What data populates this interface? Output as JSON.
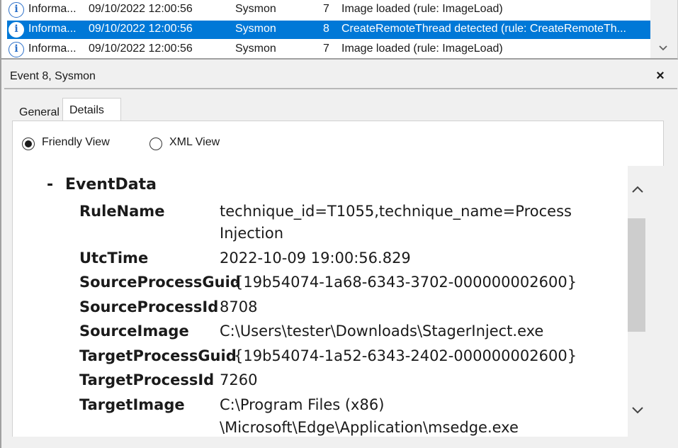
{
  "event_list": {
    "rows": [
      {
        "level": "Informa...",
        "date": "09/10/2022 12:00:56",
        "source": "Sysmon",
        "id": "7",
        "task": "Image loaded (rule: ImageLoad)",
        "selected": false
      },
      {
        "level": "Informa...",
        "date": "09/10/2022 12:00:56",
        "source": "Sysmon",
        "id": "8",
        "task": "CreateRemoteThread detected (rule: CreateRemoteTh...",
        "selected": true
      },
      {
        "level": "Informa...",
        "date": "09/10/2022 12:00:56",
        "source": "Sysmon",
        "id": "7",
        "task": "Image loaded (rule: ImageLoad)",
        "selected": false
      }
    ],
    "scroll_down_icon": "chevron-down-icon"
  },
  "details_pane": {
    "title": "Event 8, Sysmon",
    "close_glyph": "×",
    "tabs": [
      {
        "label": "General",
        "active": false
      },
      {
        "label": "Details",
        "active": true
      }
    ],
    "view_options": {
      "friendly": "Friendly View",
      "xml": "XML View",
      "selected": "Friendly View"
    },
    "event_data": {
      "collapse_glyph": "-",
      "section_title": "EventData",
      "fields": [
        {
          "name": "RuleName",
          "value": "technique_id=T1055,technique_name=Process",
          "value2": "Injection"
        },
        {
          "name": "UtcTime",
          "value": "2022-10-09 19:00:56.829"
        },
        {
          "name": "SourceProcessGuid",
          "value": "{19b54074-1a68-6343-3702-000000002600}"
        },
        {
          "name": "SourceProcessId",
          "value": "8708"
        },
        {
          "name": "SourceImage",
          "value": "C:\\Users\\tester\\Downloads\\StagerInject.exe"
        },
        {
          "name": "TargetProcessGuid",
          "value": "{19b54074-1a52-6343-2402-000000002600}"
        },
        {
          "name": "TargetProcessId",
          "value": "7260"
        },
        {
          "name": "TargetImage",
          "value": "C:\\Program Files (x86)",
          "value2": "\\Microsoft\\Edge\\Application\\msedge.exe"
        }
      ]
    }
  },
  "colors": {
    "selection": "#0078d7",
    "info_icon": "#2a6fc9"
  }
}
